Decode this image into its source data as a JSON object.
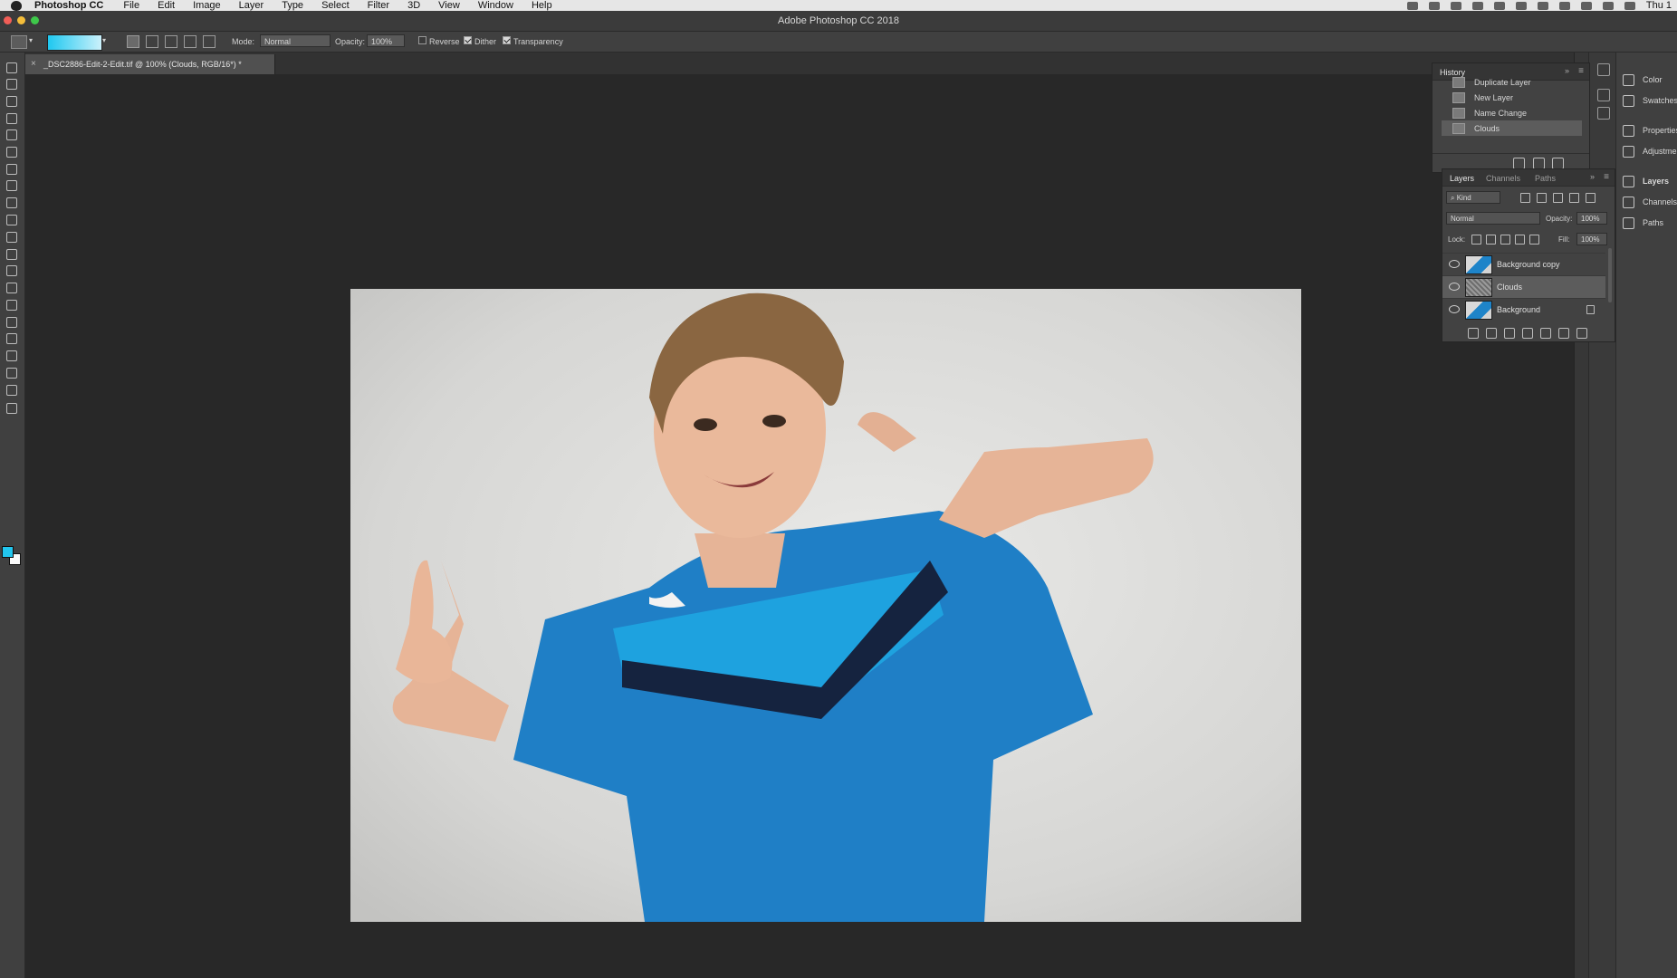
{
  "menubar": {
    "app_name": "Photoshop CC",
    "items": [
      "File",
      "Edit",
      "Image",
      "Layer",
      "Type",
      "Select",
      "Filter",
      "3D",
      "View",
      "Window",
      "Help"
    ],
    "clock": "Thu 1"
  },
  "window": {
    "title": "Adobe Photoshop CC 2018"
  },
  "options": {
    "mode_label": "Mode:",
    "mode_value": "Normal",
    "opacity_label": "Opacity:",
    "opacity_value": "100%",
    "reverse_label": "Reverse",
    "reverse_checked": false,
    "dither_label": "Dither",
    "dither_checked": true,
    "transparency_label": "Transparency",
    "transparency_checked": true,
    "gradient_colors": [
      "#1fc8f0",
      "#cbf1fb"
    ]
  },
  "tools": [
    "move-icon",
    "marquee-icon",
    "lasso-icon",
    "quick-selection-icon",
    "crop-icon",
    "eyedropper-icon",
    "healing-brush-icon",
    "brush-icon",
    "clone-stamp-icon",
    "history-brush-icon",
    "eraser-icon",
    "gradient-icon",
    "blur-icon",
    "dodge-icon",
    "pen-icon",
    "type-icon",
    "path-selection-icon",
    "rectangle-icon",
    "hand-icon",
    "zoom-icon",
    "more-tools-icon"
  ],
  "colors": {
    "foreground": "#22c6ee",
    "background": "#fafafa"
  },
  "document": {
    "tab_title": "_DSC2886-Edit-2-Edit.tif @ 100% (Clouds, RGB/16*) *"
  },
  "history": {
    "title": "History",
    "items": [
      {
        "label": "Duplicate Layer",
        "selected": false
      },
      {
        "label": "New Layer",
        "selected": false
      },
      {
        "label": "Name Change",
        "selected": false
      },
      {
        "label": "Clouds",
        "selected": true
      }
    ]
  },
  "dock": {
    "group1": [
      "Color",
      "Swatches",
      "Properties",
      "Adjustments"
    ],
    "group2": [
      "Layers",
      "Channels",
      "Paths"
    ]
  },
  "layers_panel": {
    "tabs": [
      "Layers",
      "Channels",
      "Paths"
    ],
    "filter_kind": "Kind",
    "blend_mode": "Normal",
    "opacity_label": "Opacity:",
    "opacity_value": "100%",
    "lock_label": "Lock:",
    "fill_label": "Fill:",
    "fill_value": "100%",
    "layers": [
      {
        "name": "Background copy",
        "thumb": "photo",
        "locked": false,
        "selected": false
      },
      {
        "name": "Clouds",
        "thumb": "clouds",
        "locked": false,
        "selected": true
      },
      {
        "name": "Background",
        "thumb": "photo",
        "locked": true,
        "selected": false
      }
    ]
  }
}
